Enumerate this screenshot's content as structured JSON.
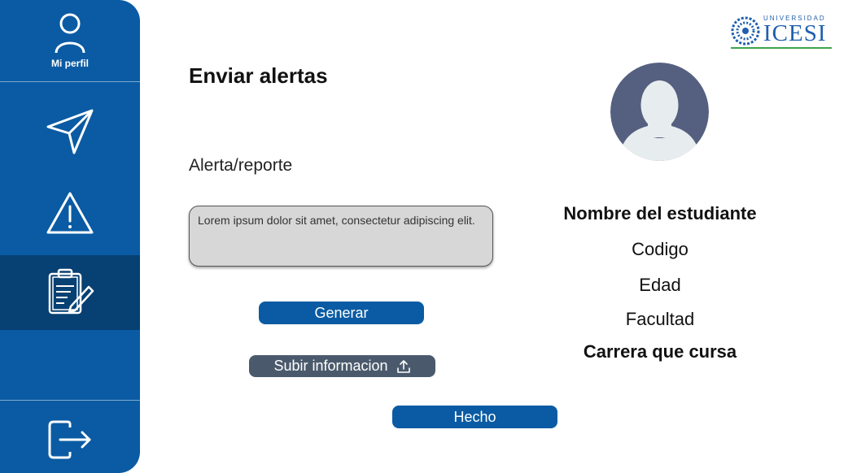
{
  "sidebar": {
    "profile_label": "Mi perfil",
    "items": [
      {
        "icon": "user-icon"
      },
      {
        "icon": "send-icon"
      },
      {
        "icon": "warning-icon"
      },
      {
        "icon": "clipboard-edit-icon",
        "active": true
      },
      {
        "icon": "logout-icon"
      }
    ]
  },
  "logo": {
    "top_text": "UNIVERSIDAD",
    "name": "ICESI"
  },
  "main": {
    "title": "Enviar alertas",
    "section_label": "Alerta/reporte",
    "alert_text": "Lorem ipsum dolor sit amet, consectetur adipiscing elit.",
    "generate_label": "Generar",
    "upload_label": "Subir informacion",
    "done_label": "Hecho"
  },
  "profile": {
    "name": "Nombre del estudiante",
    "code": "Codigo",
    "age": "Edad",
    "faculty": "Facultad",
    "career": "Carrera que cursa"
  },
  "colors": {
    "sidebar": "#0a5ba3",
    "sidebar_active": "#074072",
    "primary_button": "#0a5ba3",
    "upload_button": "#4a5a6c",
    "avatar_bg": "#556080"
  }
}
